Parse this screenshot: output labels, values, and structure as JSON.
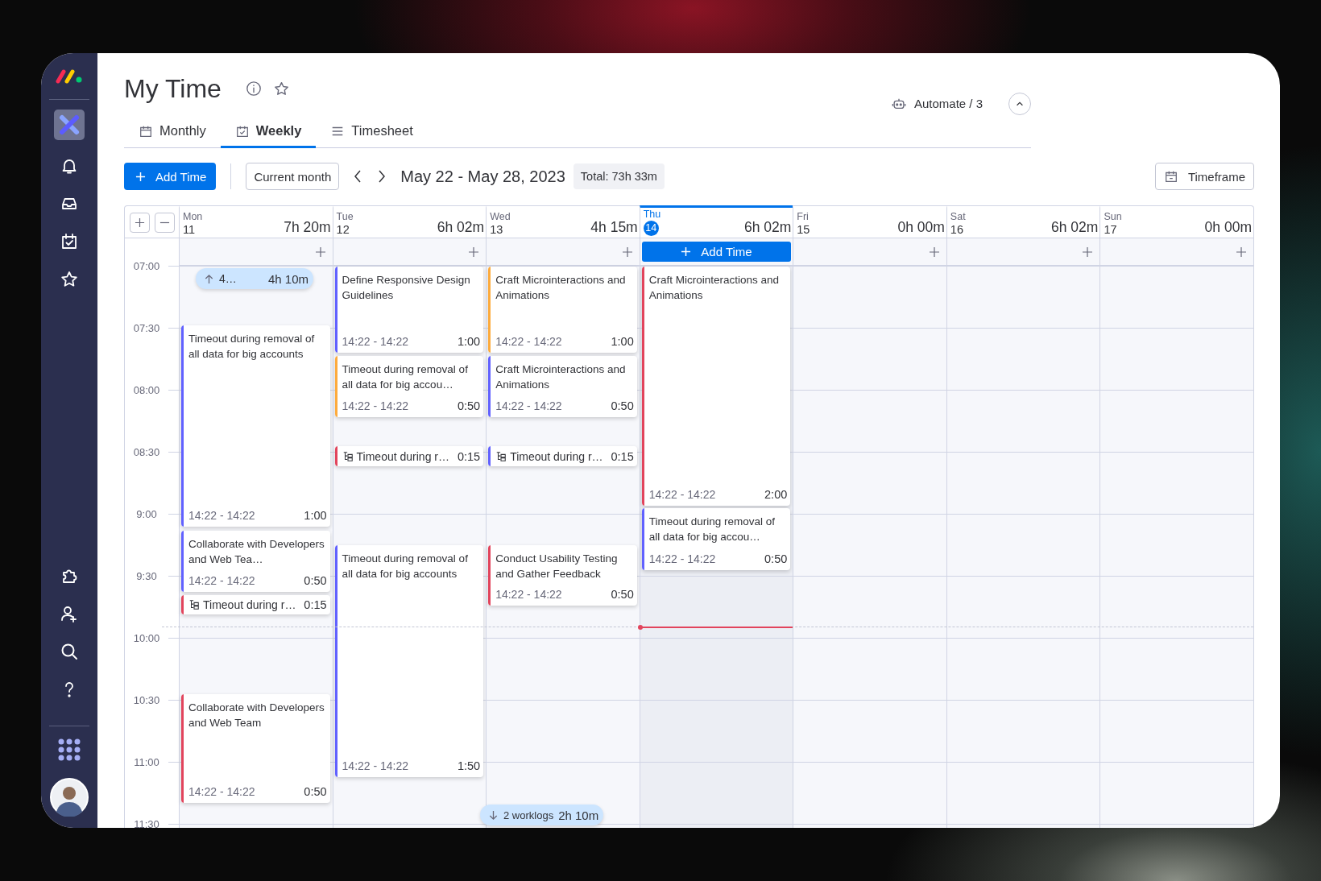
{
  "page": {
    "title": "My Time"
  },
  "tabs": [
    {
      "label": "Monthly",
      "selected": false
    },
    {
      "label": "Weekly",
      "selected": true
    },
    {
      "label": "Timesheet",
      "selected": false
    }
  ],
  "automate": {
    "label": "Automate / 3"
  },
  "toolbar": {
    "add_button": "Add Time",
    "current_month": "Current month",
    "range": "May 22 - May 28, 2023",
    "total": "Total: 73h 33m",
    "timeframe": "Timeframe"
  },
  "time_labels": [
    "07:00",
    "07:30",
    "08:00",
    "08:30",
    "9:00",
    "9:30",
    "10:00",
    "10:30",
    "11:00",
    "11:30"
  ],
  "days": [
    {
      "weekday": "Mon",
      "date": "11",
      "total": "7h 20m",
      "today": false,
      "hidden_above": {
        "label": "4…",
        "duration": "4h 10m"
      },
      "events": [
        {
          "kind": "entry",
          "title": "Timeout during removal of all data for big accounts",
          "time": "14:22 - 14:22",
          "duration": "1:00",
          "color": "#6161ff"
        },
        {
          "kind": "entry",
          "title": "Collaborate with Developers and Web Tea…",
          "time": "14:22 - 14:22",
          "duration": "0:50",
          "color": "#6161ff"
        },
        {
          "kind": "subtask",
          "title": "Timeout during r…",
          "duration": "0:15",
          "color": "#e2445c"
        },
        {
          "kind": "entry",
          "title": "Collaborate with Developers and Web Team",
          "time": "14:22 - 14:22",
          "duration": "0:50",
          "color": "#e2445c"
        }
      ]
    },
    {
      "weekday": "Tue",
      "date": "12",
      "total": "6h 02m",
      "today": false,
      "events": [
        {
          "kind": "entry",
          "title": "Define Responsive Design Guidelines",
          "time": "14:22 - 14:22",
          "duration": "1:00",
          "color": "#6161ff"
        },
        {
          "kind": "entry",
          "title": "Timeout during removal of all data for big accou…",
          "time": "14:22 - 14:22",
          "duration": "0:50",
          "color": "#fdab3d"
        },
        {
          "kind": "subtask",
          "title": "Timeout during r…",
          "duration": "0:15",
          "color": "#e2445c"
        },
        {
          "kind": "entry",
          "title": "Timeout during removal of all data for big accounts",
          "time": "14:22 - 14:22",
          "duration": "1:50",
          "color": "#6161ff"
        }
      ]
    },
    {
      "weekday": "Wed",
      "date": "13",
      "total": "4h 15m",
      "today": false,
      "events": [
        {
          "kind": "entry",
          "title": "Craft Microinteractions and Animations",
          "time": "14:22 - 14:22",
          "duration": "1:00",
          "color": "#fdab3d"
        },
        {
          "kind": "entry",
          "title": "Craft Microinteractions and Animations",
          "time": "14:22 - 14:22",
          "duration": "0:50",
          "color": "#6161ff"
        },
        {
          "kind": "subtask",
          "title": "Timeout during r…",
          "duration": "0:15",
          "color": "#6161ff"
        },
        {
          "kind": "entry",
          "title": "Conduct Usability Testing and Gather Feedback",
          "time": "14:22 - 14:22",
          "duration": "0:50",
          "color": "#e2445c"
        }
      ]
    },
    {
      "weekday": "Thu",
      "date": "14",
      "total": "6h 02m",
      "today": true,
      "add_label": "Add Time",
      "events": [
        {
          "kind": "entry",
          "title": "Craft Microinteractions and Animations",
          "time": "14:22 - 14:22",
          "duration": "2:00",
          "color": "#e2445c"
        },
        {
          "kind": "entry",
          "title": "Timeout during removal of all data for big accou…",
          "time": "14:22 - 14:22",
          "duration": "0:50",
          "color": "#6161ff"
        }
      ]
    },
    {
      "weekday": "Fri",
      "date": "15",
      "total": "0h 00m",
      "today": false
    },
    {
      "weekday": "Sat",
      "date": "16",
      "total": "6h 02m",
      "today": false
    },
    {
      "weekday": "Sun",
      "date": "17",
      "total": "0h 00m",
      "today": false
    }
  ],
  "hidden_below": {
    "label": "2 worklogs",
    "duration": "2h 10m"
  }
}
